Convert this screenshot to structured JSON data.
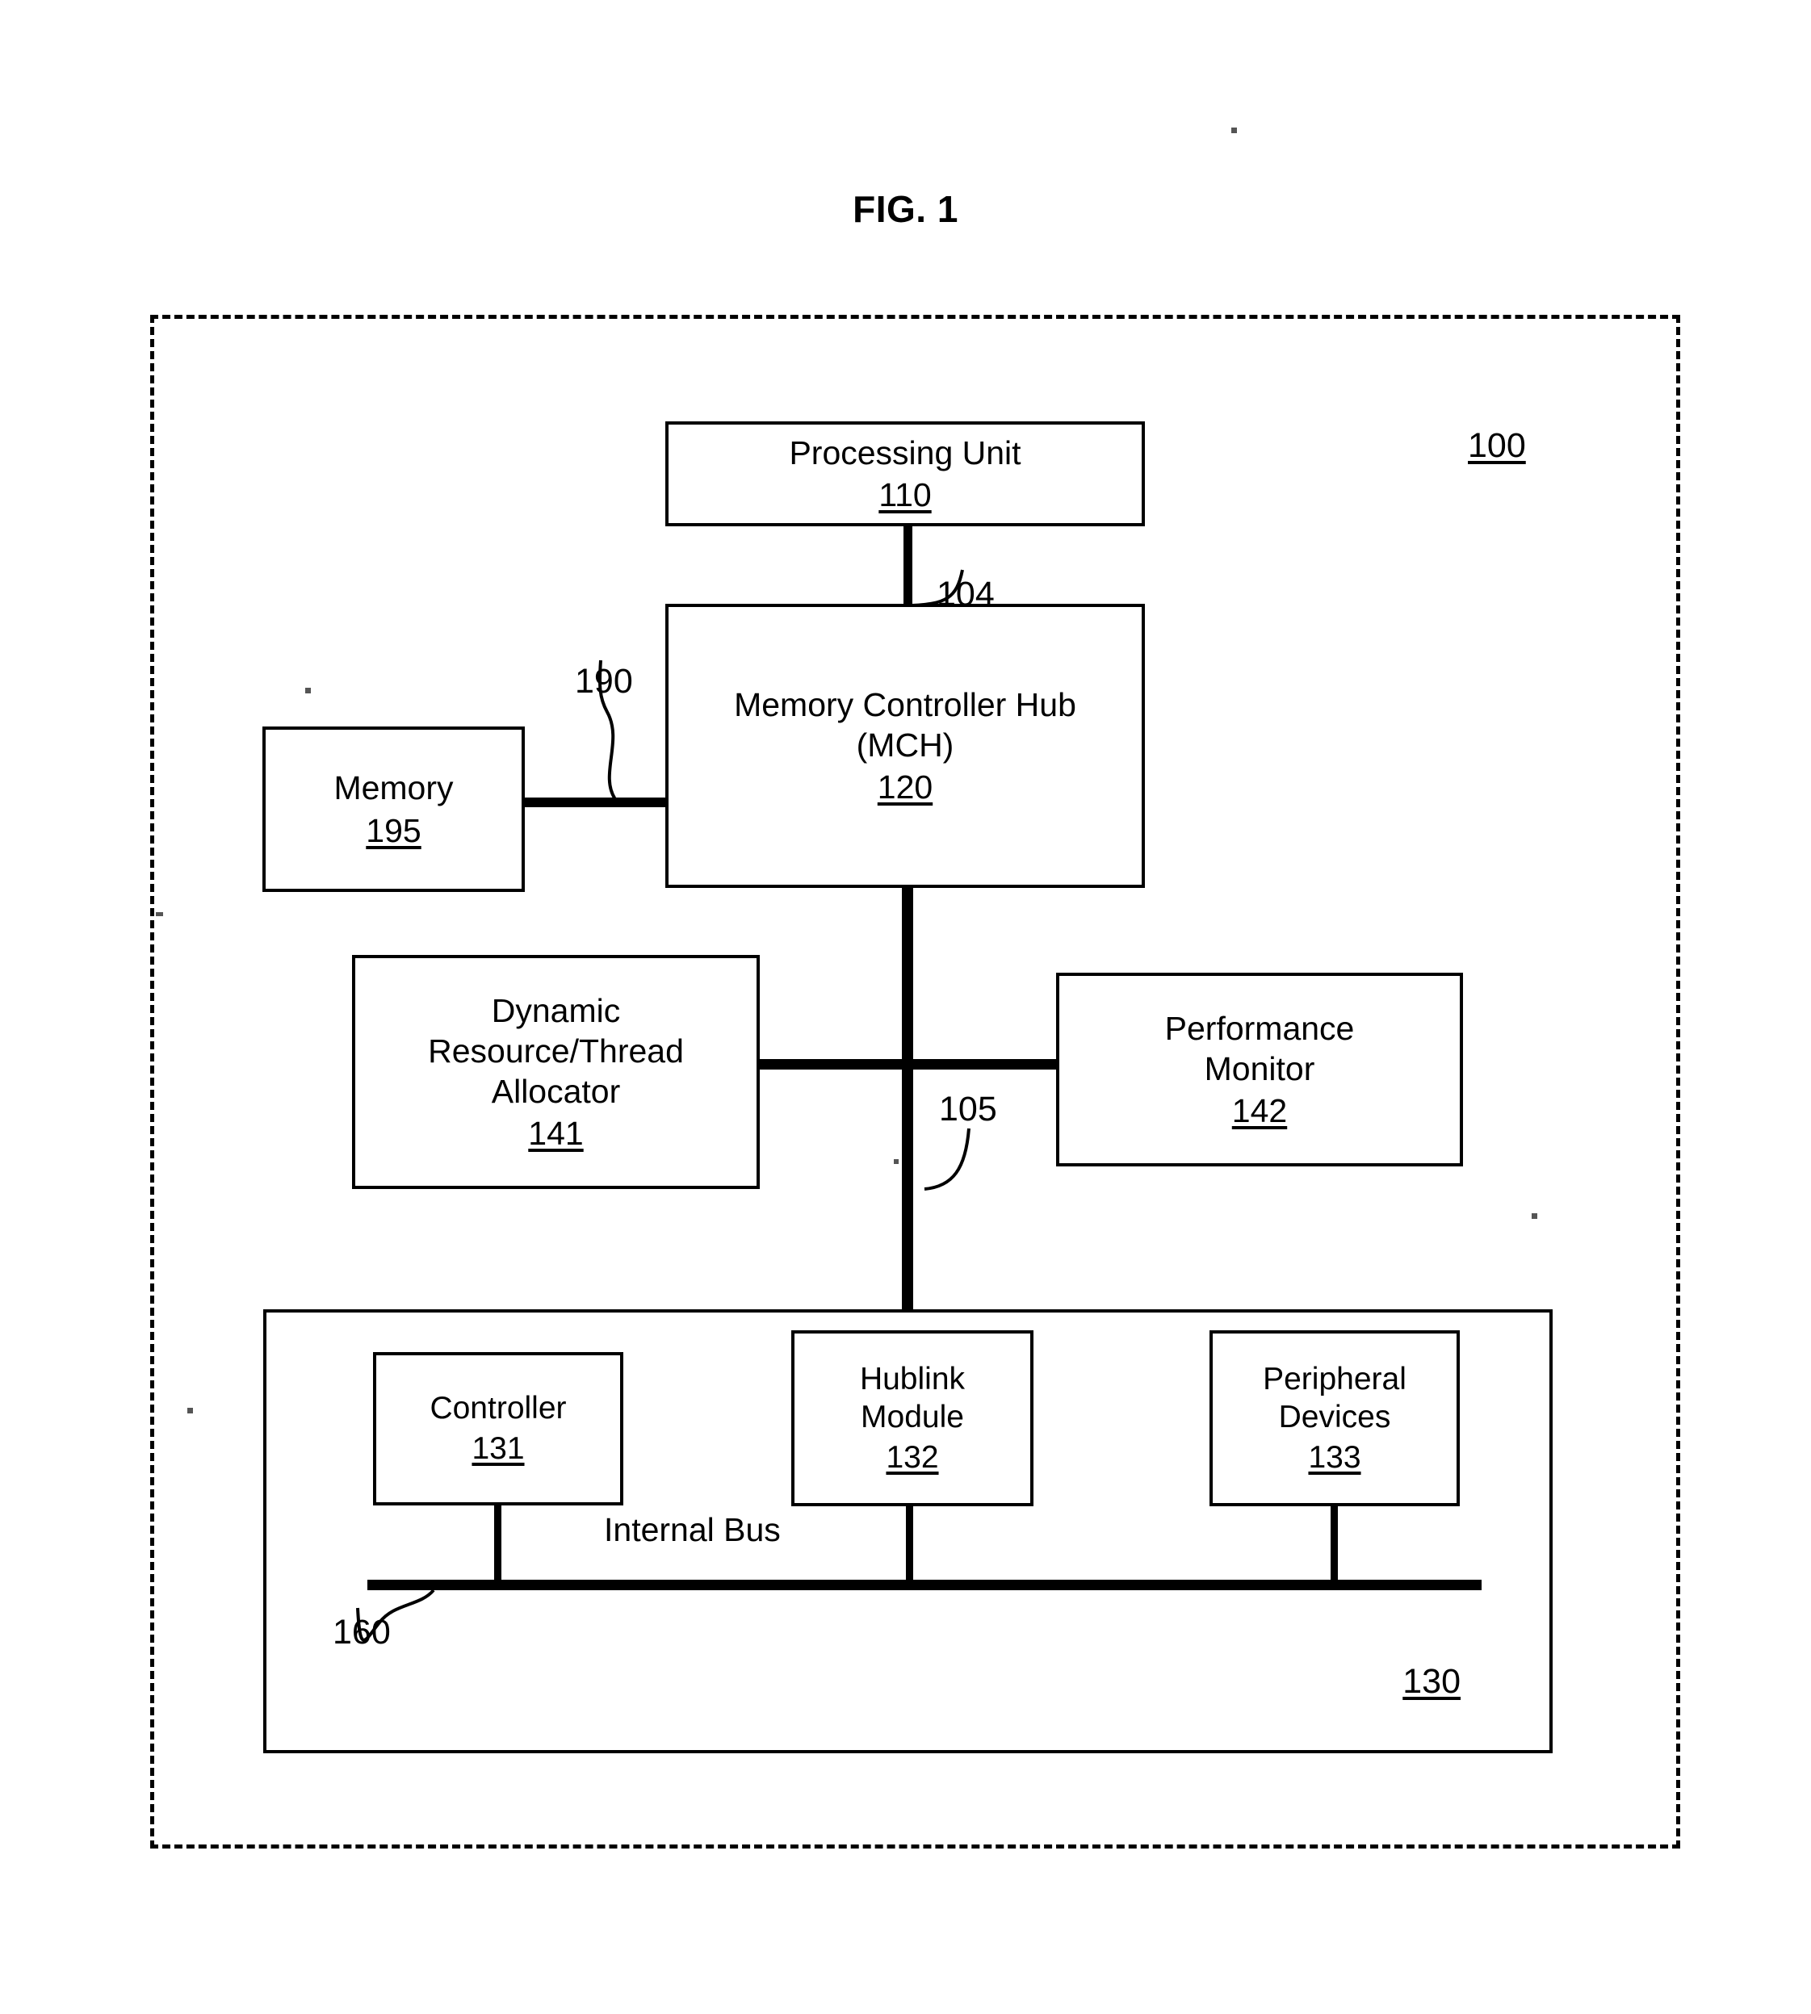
{
  "figure": {
    "title": "FIG. 1",
    "system_refnum": "100"
  },
  "blocks": {
    "processing_unit": {
      "title": "Processing Unit",
      "refnum": "110"
    },
    "mch": {
      "title_line1": "Memory Controller Hub",
      "title_line2": "(MCH)",
      "refnum": "120"
    },
    "memory": {
      "title": "Memory",
      "refnum": "195"
    },
    "allocator": {
      "title_line1": "Dynamic",
      "title_line2": "Resource/Thread",
      "title_line3": "Allocator",
      "refnum": "141"
    },
    "performance_monitor": {
      "title_line1": "Performance",
      "title_line2": "Monitor",
      "refnum": "142"
    },
    "chipset": {
      "refnum": "130"
    },
    "controller": {
      "title": "Controller",
      "refnum": "131"
    },
    "hublink": {
      "title_line1": "Hublink",
      "title_line2": "Module",
      "refnum": "132"
    },
    "peripheral": {
      "title_line1": "Peripheral",
      "title_line2": "Devices",
      "refnum": "133"
    }
  },
  "connections": {
    "processor_bus_label": "104",
    "memory_bus_label": "190",
    "hub_interface_label": "105",
    "internal_bus_label": "Internal Bus",
    "internal_bus_refnum": "160"
  },
  "colors": {
    "ink": "#000000",
    "paper": "#ffffff"
  }
}
